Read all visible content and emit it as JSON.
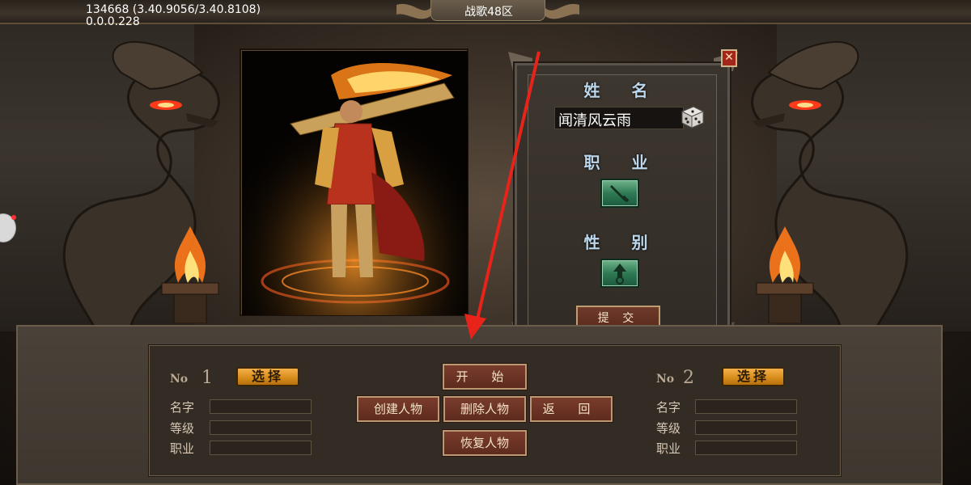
{
  "top_bar": {
    "version": "134668 (3.40.9056/3.40.8108)",
    "build": "0.0.0.228",
    "server_name": "战歌48区"
  },
  "create_panel": {
    "name_heading": "姓 名",
    "name_value": "闻清风云雨",
    "job_heading": "职 业",
    "gender_heading": "性 别",
    "submit_label": "提 交",
    "close_label": "✕"
  },
  "slots": [
    {
      "no_label": "No",
      "no_number": "1",
      "select_label": "选择",
      "name_label": "名字",
      "level_label": "等级",
      "job_label": "职业"
    },
    {
      "no_label": "No",
      "no_number": "2",
      "select_label": "选择",
      "name_label": "名字",
      "level_label": "等级",
      "job_label": "职业"
    }
  ],
  "menu": {
    "start": "开 始",
    "create_character": "创建人物",
    "delete_character": "删除人物",
    "back": "返 回",
    "restore_character": "恢复人物"
  },
  "colors": {
    "heading": "#bcd7ec",
    "select_button": "#e09a2a",
    "menu_button": "#6a3325",
    "arrow": "#e8231a"
  }
}
